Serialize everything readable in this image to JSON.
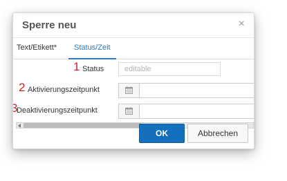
{
  "dialog": {
    "title": "Sperre neu",
    "close_glyph": "×"
  },
  "tabs": [
    {
      "label": "Text/Etikett*",
      "active": false
    },
    {
      "label": "Status/Zeit",
      "active": true
    }
  ],
  "form": {
    "status": {
      "number": "1",
      "label": "Status",
      "placeholder": "editable"
    },
    "aktivierung": {
      "number": "2",
      "label": "Aktivierungszeitpunkt",
      "icon": "calendar-icon"
    },
    "deaktivierung": {
      "number": "3",
      "label": "Deaktivierungszeitpunkt",
      "icon": "calendar-icon"
    }
  },
  "buttons": {
    "ok": "OK",
    "cancel": "Abbrechen"
  },
  "colors": {
    "accent": "#1470bd",
    "annotation_numbers": "#d0202a",
    "active_tab": "#2a7ab8"
  }
}
